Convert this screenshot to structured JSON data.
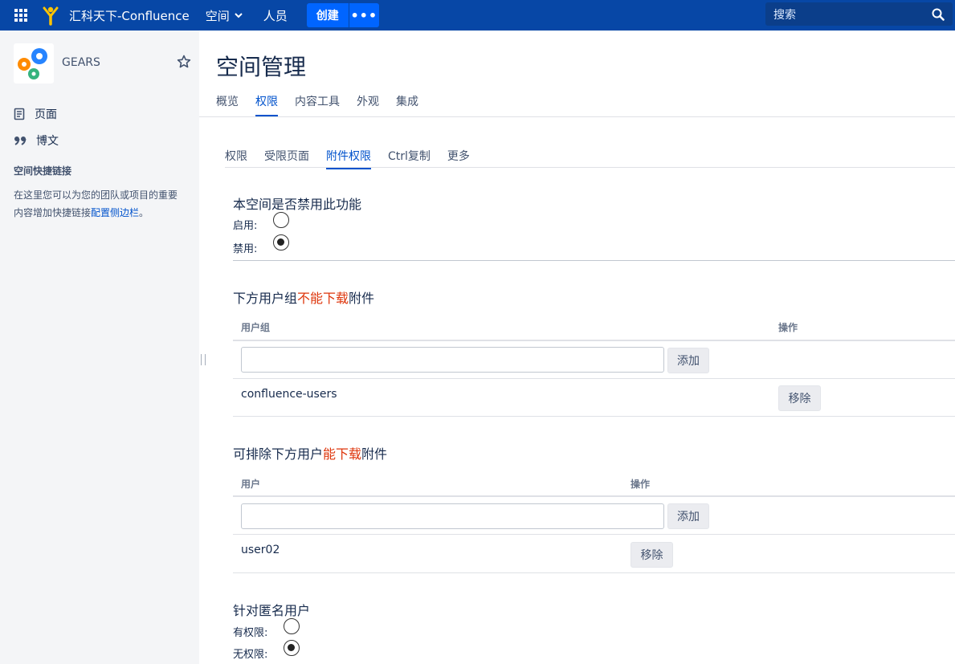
{
  "topbar": {
    "brand": "汇科天下-Confluence",
    "nav_spaces": "空间",
    "nav_people": "人员",
    "create_label": "创建",
    "more_label": "•••",
    "search_placeholder": "搜索"
  },
  "sidebar": {
    "space_name": "GEARS",
    "items": [
      {
        "label": "页面",
        "icon": "page-icon"
      },
      {
        "label": "博文",
        "icon": "quote-icon"
      }
    ],
    "shortcuts_heading": "空间快捷链接",
    "shortcuts_desc": "在这里您可以为您的团队或项目的重要内容增加快捷链接",
    "shortcuts_link": "配置侧边栏",
    "shortcuts_end": "。"
  },
  "main": {
    "title": "空间管理",
    "tabs": [
      "概览",
      "权限",
      "内容工具",
      "外观",
      "集成"
    ],
    "subtabs": [
      "权限",
      "受限页面",
      "附件权限",
      "Ctrl复制",
      "更多"
    ],
    "disable_section": {
      "title": "本空间是否禁用此功能",
      "enable_label": "启用:",
      "disable_label": "禁用:",
      "selected": "disable"
    },
    "group_section": {
      "title_pre": "下方用户组",
      "title_red": "不能下载",
      "title_post": "附件",
      "col_name": "用户组",
      "col_action": "操作",
      "add_label": "添加",
      "rows": [
        {
          "name": "confluence-users",
          "action": "移除"
        }
      ]
    },
    "user_section": {
      "title_pre": "可排除下方用户",
      "title_red": "能下载",
      "title_post": "附件",
      "col_name": "用户",
      "col_action": "操作",
      "add_label": "添加",
      "rows": [
        {
          "name": "user02",
          "action": "移除"
        }
      ]
    },
    "anon_section": {
      "title": "针对匿名用户",
      "has_label": "有权限:",
      "none_label": "无权限:",
      "selected": "none"
    }
  },
  "colors": {
    "topbar": "#0747A6",
    "accent": "#0052CC",
    "warning_red": "#DE350B"
  }
}
